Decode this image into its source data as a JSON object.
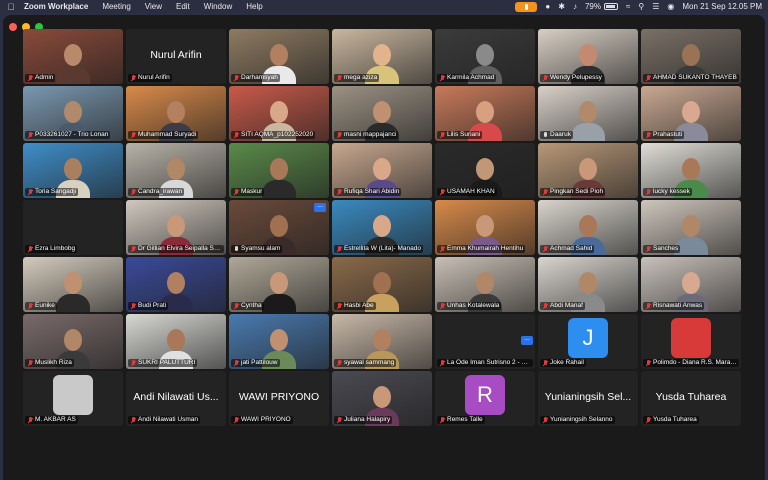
{
  "menubar": {
    "app_name": "Zoom Workplace",
    "menus": [
      "Meeting",
      "View",
      "Edit",
      "Window",
      "Help"
    ],
    "battery": "79%",
    "datetime": "Mon 21 Sep  12.05 PM"
  },
  "gallery": [
    {
      "name": "Admin",
      "muted": true,
      "kind": "video",
      "bg": "#8a4a3a",
      "skin": "#b98a6a",
      "shirt": "#5a3a30"
    },
    {
      "name": "Nurul Arifin",
      "muted": true,
      "kind": "name",
      "center_name": "Nurul Arifin"
    },
    {
      "name": "Darhamsyah",
      "muted": true,
      "kind": "video",
      "bg": "#8e7b62",
      "skin": "#b08060",
      "shirt": "#e9e9e9"
    },
    {
      "name": "mega aziza",
      "muted": true,
      "kind": "video",
      "bg": "#c9b79f",
      "skin": "#e3b48c",
      "shirt": "#d8c37a"
    },
    {
      "name": "Karmila Achmad",
      "muted": true,
      "kind": "video",
      "bg": "#3b3b3b",
      "skin": "#8a8a8a",
      "shirt": "#606060"
    },
    {
      "name": "Wendy Pelupessy",
      "muted": true,
      "kind": "video",
      "bg": "#d8cfc4",
      "skin": "#c48a70",
      "shirt": "#2f2f2f"
    },
    {
      "name": "AHMAD SUKANTO THAYEB",
      "muted": true,
      "kind": "video",
      "bg": "#7a7066",
      "skin": "#9a7356",
      "shirt": "#3a3a3a"
    },
    {
      "name": "P033261027 - Trio Lonan",
      "muted": true,
      "kind": "video",
      "bg": "#7a98b0",
      "skin": "#b08a6a",
      "shirt": "#4a5a6a"
    },
    {
      "name": "Muhammad Suryadi",
      "muted": true,
      "kind": "video",
      "bg": "#d98a4a",
      "skin": "#b58060",
      "shirt": "#3c3c46"
    },
    {
      "name": "SITI AQMA_p102252020",
      "muted": true,
      "kind": "video",
      "bg": "#c85a4a",
      "skin": "#d8a888",
      "shirt": "#c8b8a0"
    },
    {
      "name": "masni mappajanci",
      "muted": true,
      "kind": "video",
      "bg": "#9c9284",
      "skin": "#c09070",
      "shirt": "#2a2a2a"
    },
    {
      "name": "Lilis Suriani",
      "muted": true,
      "kind": "video",
      "bg": "#c87a5a",
      "skin": "#d8a080",
      "shirt": "#d84a4a"
    },
    {
      "name": "Daaruk",
      "muted": false,
      "kind": "video",
      "bg": "#d8d0c8",
      "skin": "#b08a6a",
      "shirt": "#9aa0a8"
    },
    {
      "name": "Prahastuti",
      "muted": true,
      "kind": "video",
      "bg": "#c9a892",
      "skin": "#d8a890",
      "shirt": "#8a8a9a"
    },
    {
      "name": "Toria Sangadji",
      "muted": true,
      "kind": "video",
      "bg": "#3f8ec9",
      "skin": "#a88060",
      "shirt": "#d8d0c0"
    },
    {
      "name": "Candra_irawan",
      "muted": true,
      "kind": "video",
      "bg": "#b8b2a8",
      "skin": "#b08868",
      "shirt": "#d8d8d8"
    },
    {
      "name": "Maskur",
      "muted": true,
      "kind": "video",
      "bg": "#5a8a4a",
      "skin": "#a87858",
      "shirt": "#2a2a2a"
    },
    {
      "name": "Rufiqa Shari Abidin",
      "muted": true,
      "kind": "video",
      "bg": "#c8a890",
      "skin": "#d8a888",
      "shirt": "#5a4a8a",
      "active": true
    },
    {
      "name": "USAMAH KHAN",
      "muted": true,
      "kind": "video",
      "bg": "#2a2a2a",
      "skin": "#c09878",
      "shirt": "#1a1a1a"
    },
    {
      "name": "Pingkan Sedi Pioh",
      "muted": true,
      "kind": "video",
      "bg": "#b89878",
      "skin": "#c89878",
      "shirt": "#6a3a3a"
    },
    {
      "name": "lucky kessek",
      "muted": true,
      "kind": "video",
      "bg": "#e0ddd6",
      "skin": "#a87858",
      "shirt": "#4a8a4a"
    },
    {
      "name": "Ezra Limbobg",
      "muted": true,
      "kind": "blank"
    },
    {
      "name": "Dr Gillian Elvira Seipalla Sp...",
      "muted": true,
      "kind": "video",
      "bg": "#d0c8be",
      "skin": "#c89878",
      "shirt": "#8a2a3a"
    },
    {
      "name": "Syamsu alam",
      "muted": false,
      "kind": "video",
      "bg": "#6a4a3a",
      "skin": "#a07050",
      "shirt": "#3a2a2a",
      "dots": true
    },
    {
      "name": "Estrellita W (Lita)- Manado",
      "muted": true,
      "kind": "video",
      "bg": "#3a8ac0",
      "skin": "#d8a888",
      "shirt": "#2a2a2a"
    },
    {
      "name": "Emma Khumairah Hentihu",
      "muted": true,
      "kind": "video",
      "bg": "#d88a4a",
      "skin": "#c89878",
      "shirt": "#7a5a8a"
    },
    {
      "name": "Achmad Sahid",
      "muted": true,
      "kind": "video",
      "bg": "#d8d4cc",
      "skin": "#a87858",
      "shirt": "#4a6a9a"
    },
    {
      "name": "Sanches",
      "muted": true,
      "kind": "video",
      "bg": "#cec6bc",
      "skin": "#b08868",
      "shirt": "#7a8a9a"
    },
    {
      "name": "Eunike",
      "muted": true,
      "kind": "video",
      "bg": "#d4cbbd",
      "skin": "#c09070",
      "shirt": "#2a2a2a"
    },
    {
      "name": "Budi Prati",
      "muted": true,
      "kind": "video",
      "bg": "#3a4a9a",
      "skin": "#b08060",
      "shirt": "#2a2a4a"
    },
    {
      "name": "Cyntha",
      "muted": true,
      "kind": "video",
      "bg": "#b0a898",
      "skin": "#c89878",
      "shirt": "#1a1a1a"
    },
    {
      "name": "Hasbi Abe",
      "muted": true,
      "kind": "video",
      "bg": "#8a6a4a",
      "skin": "#a07050",
      "shirt": "#c8a060"
    },
    {
      "name": "Unhas Kotalewala",
      "muted": true,
      "kind": "video",
      "bg": "#c8bfb4",
      "skin": "#b08868",
      "shirt": "#3a3a3a"
    },
    {
      "name": "Abdi Manaf",
      "muted": true,
      "kind": "video",
      "bg": "#d8d4ce",
      "skin": "#b08868",
      "shirt": "#8a8a8a"
    },
    {
      "name": "Risnawati Anwas",
      "muted": true,
      "kind": "video",
      "bg": "#c8c0ba",
      "skin": "#d8a890",
      "shirt": "#6a6a7a"
    },
    {
      "name": "Muslikh Riza",
      "muted": true,
      "kind": "video",
      "bg": "#7a6a6a",
      "skin": "#b08868",
      "shirt": "#3a3a3a"
    },
    {
      "name": "SUKRI PALUTTURI",
      "muted": true,
      "kind": "video",
      "bg": "#d8d8d4",
      "skin": "#a87858",
      "shirt": "#e0e0e0"
    },
    {
      "name": "jati Pattilouw",
      "muted": true,
      "kind": "video",
      "bg": "#4a7ab0",
      "skin": "#c09070",
      "shirt": "#6a8a5a"
    },
    {
      "name": "syawal sammang",
      "muted": true,
      "kind": "video",
      "bg": "#c8b8a8",
      "skin": "#b08060",
      "shirt": "#b89858"
    },
    {
      "name": "La Ode Iman Sutrisno 2 - S...",
      "muted": true,
      "kind": "blank",
      "dots": true
    },
    {
      "name": "Joke Rahail",
      "muted": true,
      "kind": "avatar",
      "letter": "J",
      "avatar_color": "#2d8ef0"
    },
    {
      "name": "Polimdo - Diana R.S. Maram...",
      "muted": true,
      "kind": "photo",
      "avatar_color": "#d83a3a"
    },
    {
      "name": "M. AKBAR AS",
      "muted": true,
      "kind": "photo",
      "avatar_color": "#c9c9c9"
    },
    {
      "name": "Andi Nilawati Usman",
      "muted": true,
      "kind": "name",
      "center_name": "Andi Nilawati Us..."
    },
    {
      "name": "WAWI PRIYONO",
      "muted": true,
      "kind": "name",
      "center_name": "WAWI PRIYONO"
    },
    {
      "name": "Juliana Halapiry",
      "muted": true,
      "kind": "video",
      "bg": "#4a4a52",
      "skin": "#c89878",
      "shirt": "#6a3a5a"
    },
    {
      "name": "Remes Talle",
      "muted": true,
      "kind": "avatar",
      "letter": "R",
      "avatar_color": "#a84cc4"
    },
    {
      "name": "Yunianingsih Selanno",
      "muted": true,
      "kind": "name",
      "center_name": "Yunianingsih Sel..."
    },
    {
      "name": "Yusda Tuharea",
      "muted": true,
      "kind": "name",
      "center_name": "Yusda Tuharea"
    }
  ]
}
